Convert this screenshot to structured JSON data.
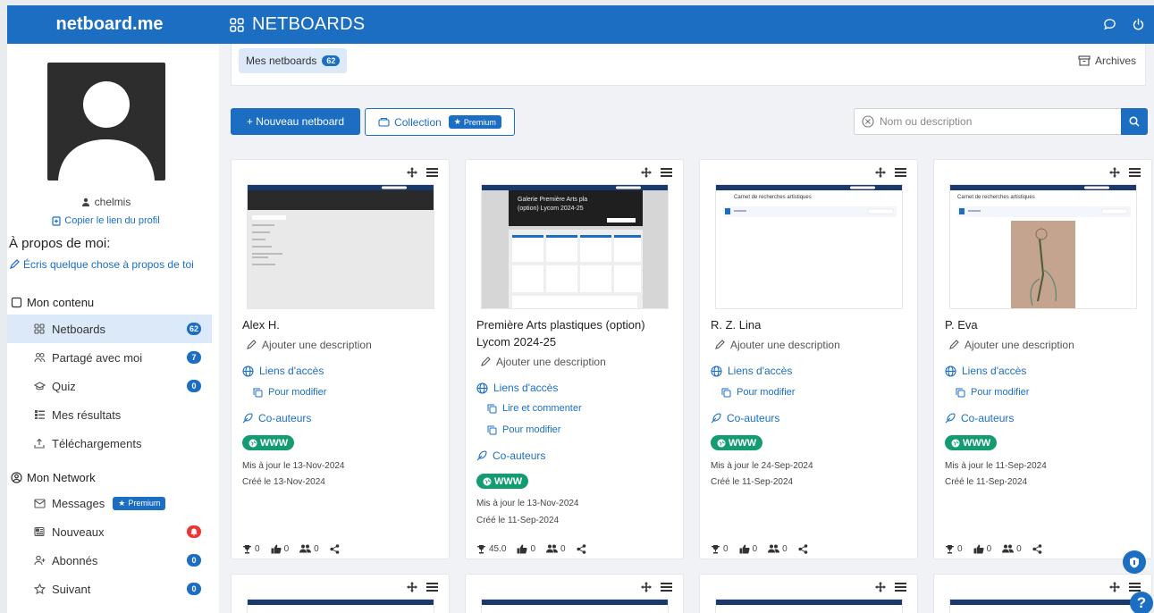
{
  "app": {
    "brand": "netboard.me",
    "title": "NETBOARDS"
  },
  "profile": {
    "username": "chelmis",
    "copy_link": "Copier le lien du profil",
    "about_heading": "À propos de moi:",
    "about_prompt": "Écris quelque chose à propos de toi"
  },
  "sidebar": {
    "my_content": "Mon contenu",
    "items": [
      {
        "label": "Netboards",
        "count": "62",
        "icon": "grid-icon"
      },
      {
        "label": "Partagé avec moi",
        "count": "7",
        "icon": "people-icon"
      },
      {
        "label": "Quiz",
        "count": "0",
        "icon": "quiz-icon"
      },
      {
        "label": "Mes résultats",
        "count": "",
        "icon": "results-icon"
      },
      {
        "label": "Téléchargements",
        "count": "",
        "icon": "upload-icon"
      }
    ],
    "my_network": "Mon Network",
    "network_items": [
      {
        "label": "Messages",
        "badge": "Premium",
        "icon": "envelope-icon"
      },
      {
        "label": "Nouveaux",
        "count": "",
        "icon": "news-icon"
      },
      {
        "label": "Abonnés",
        "count": "0",
        "icon": "user-plus-icon"
      },
      {
        "label": "Suivant",
        "count": "0",
        "icon": "star-icon"
      }
    ]
  },
  "tabs": {
    "mine_label": "Mes netboards",
    "mine_count": "62",
    "archives": "Archives"
  },
  "toolbar": {
    "new_label": "+ Nouveau netboard",
    "collection_label": "Collection",
    "premium_label": "Premium",
    "search_placeholder": "Nom ou description"
  },
  "cards": [
    {
      "title": "Alex H.",
      "add_desc": "Ajouter une description",
      "access": "Liens d'accès",
      "links": [
        "Pour modifier"
      ],
      "coauthors": "Co-auteurs",
      "www": "WWW",
      "updated": "Mis à jour le 13-Nov-2024",
      "created": "Créé le 13-Nov-2024",
      "stats": [
        "0",
        "0",
        "0"
      ]
    },
    {
      "title": "Première Arts plastiques (option) Lycom 2024-25",
      "thumb_lines": [
        "Galerie Première Arts pla",
        "(option) Lycom 2024-25"
      ],
      "add_desc": "Ajouter une description",
      "access": "Liens d'accès",
      "links": [
        "Lire et commenter",
        "Pour modifier"
      ],
      "coauthors": "Co-auteurs",
      "www": "WWW",
      "updated": "Mis à jour le 13-Nov-2024",
      "created": "Créé le 11-Sep-2024",
      "stats": [
        "45.0",
        "0",
        "0"
      ]
    },
    {
      "title": "R. Z. Lina",
      "thumb_caption": "Carnet de recherches artistiques",
      "add_desc": "Ajouter une description",
      "access": "Liens d'accès",
      "links": [
        "Pour modifier"
      ],
      "coauthors": "Co-auteurs",
      "www": "WWW",
      "updated": "Mis à jour le 24-Sep-2024",
      "created": "Créé le 11-Sep-2024",
      "stats": [
        "0",
        "0",
        "0"
      ]
    },
    {
      "title": "P. Eva",
      "thumb_caption": "Carnet de recherches artistiques",
      "add_desc": "Ajouter une description",
      "access": "Liens d'accès",
      "links": [
        "Pour modifier"
      ],
      "coauthors": "Co-auteurs",
      "www": "WWW",
      "updated": "Mis à jour le 11-Sep-2024",
      "created": "Créé le 11-Sep-2024",
      "stats": [
        "0",
        "0",
        "0"
      ]
    }
  ],
  "help": "?",
  "colors": {
    "primary": "#1b6ec2",
    "www": "#139c72",
    "alert": "#e33333"
  }
}
